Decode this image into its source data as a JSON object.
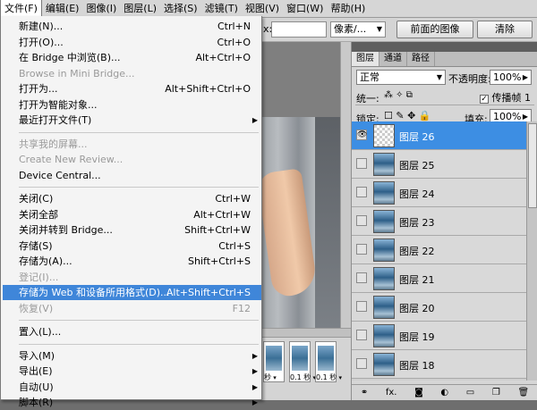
{
  "menubar": {
    "items": [
      {
        "label": "文件(F)",
        "active": true
      },
      {
        "label": "编辑(E)"
      },
      {
        "label": "图像(I)"
      },
      {
        "label": "图层(L)"
      },
      {
        "label": "选择(S)"
      },
      {
        "label": "滤镜(T)"
      },
      {
        "label": "视图(V)"
      },
      {
        "label": "窗口(W)"
      },
      {
        "label": "帮助(H)"
      }
    ]
  },
  "options_bar": {
    "gap_label": "x:",
    "unit_value": "像素/...",
    "front_image_button": "前面的图像",
    "clear_button": "清除"
  },
  "file_menu": {
    "items": [
      {
        "label": "新建(N)...",
        "shortcut": "Ctrl+N"
      },
      {
        "label": "打开(O)...",
        "shortcut": "Ctrl+O"
      },
      {
        "label": "在 Bridge 中浏览(B)...",
        "shortcut": "Alt+Ctrl+O"
      },
      {
        "label": "Browse in Mini Bridge...",
        "shortcut": "",
        "disabled": true
      },
      {
        "label": "打开为...",
        "shortcut": "Alt+Shift+Ctrl+O"
      },
      {
        "label": "打开为智能对象...",
        "shortcut": ""
      },
      {
        "label": "最近打开文件(T)",
        "shortcut": "",
        "submenu": true
      },
      {
        "label": "共享我的屏幕...",
        "shortcut": "",
        "disabled": true
      },
      {
        "label": "Create New Review...",
        "shortcut": "",
        "disabled": true
      },
      {
        "label": "Device Central...",
        "shortcut": ""
      },
      {
        "label": "关闭(C)",
        "shortcut": "Ctrl+W"
      },
      {
        "label": "关闭全部",
        "shortcut": "Alt+Ctrl+W"
      },
      {
        "label": "关闭并转到 Bridge...",
        "shortcut": "Shift+Ctrl+W"
      },
      {
        "label": "存储(S)",
        "shortcut": "Ctrl+S"
      },
      {
        "label": "存储为(A)...",
        "shortcut": "Shift+Ctrl+S"
      },
      {
        "label": "登记(I)...",
        "shortcut": "",
        "disabled": true
      },
      {
        "label": "存储为 Web 和设备所用格式(D)...",
        "shortcut": "Alt+Shift+Ctrl+S",
        "highlighted": true
      },
      {
        "label": "恢复(V)",
        "shortcut": "F12",
        "disabled": true
      },
      {
        "label": "置入(L)...",
        "shortcut": ""
      },
      {
        "label": "导入(M)",
        "shortcut": "",
        "submenu": true
      },
      {
        "label": "导出(E)",
        "shortcut": "",
        "submenu": true
      },
      {
        "label": "自动(U)",
        "shortcut": "",
        "submenu": true
      },
      {
        "label": "脚本(R)",
        "shortcut": "",
        "submenu": true
      }
    ],
    "submenu_arrow": "▶"
  },
  "animation": {
    "frames": [
      {
        "num": "",
        "delay": "秒"
      },
      {
        "num": "",
        "delay": "0.1 秒"
      },
      {
        "num": "",
        "delay": "0.1 秒"
      }
    ]
  },
  "layers_panel": {
    "tabs": [
      "图层",
      "通道",
      "路径"
    ],
    "blend_mode": "正常",
    "opacity_label": "不透明度:",
    "opacity_value": "100%",
    "unify_label": "统一:",
    "propagate_label": "传播帧 1",
    "lock_label": "锁定:",
    "fill_label": "填充:",
    "fill_value": "100%",
    "layers": [
      {
        "name": "图层 26",
        "selected": true
      },
      {
        "name": "图层 25"
      },
      {
        "name": "图层 24"
      },
      {
        "name": "图层 23"
      },
      {
        "name": "图层 22"
      },
      {
        "name": "图层 21"
      },
      {
        "name": "图层 20"
      },
      {
        "name": "图层 19"
      },
      {
        "name": "图层 18"
      }
    ],
    "bottom_icons": [
      "link-icon",
      "fx-icon",
      "mask-icon",
      "adjustment-icon",
      "group-icon",
      "new-layer-icon",
      "trash-icon"
    ],
    "fx_label": "fx."
  },
  "colors": {
    "highlight": "#3f86d9",
    "layer_selected": "#3d8ee3"
  }
}
